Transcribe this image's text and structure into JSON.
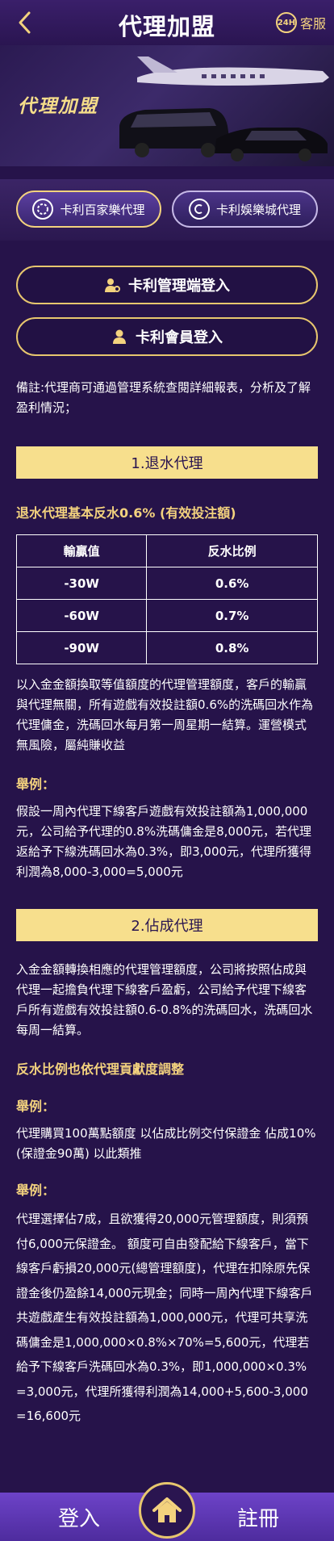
{
  "header": {
    "back_icon": "chevron-left-icon",
    "title": "代理加盟",
    "cs_icon_text": "24H",
    "cs_label": "客服",
    "accent_color": "#f3d27e"
  },
  "banner": {
    "title": "代理加盟"
  },
  "tabs": [
    {
      "label": "卡利百家樂代理",
      "icon": "chip-icon"
    },
    {
      "label": "卡利娛樂城代理",
      "icon": "casino-logo-icon"
    }
  ],
  "buttons": {
    "admin_login": "卡利管理端登入",
    "member_login": "卡利會員登入"
  },
  "note": "備註:代理商可通過管理系統查閱詳細報表，分析及了解盈利情況；",
  "section1": {
    "bar": "1.退水代理",
    "heading": "退水代理基本反水0.6% (有效投注額)",
    "table": {
      "headers": [
        "輸贏值",
        "反水比例"
      ],
      "rows": [
        [
          "-30W",
          "0.6%"
        ],
        [
          "-60W",
          "0.7%"
        ],
        [
          "-90W",
          "0.8%"
        ]
      ]
    },
    "desc": "以入金金額換取等值額度的代理管理額度，客戶的輸贏與代理無關，所有遊戲有效投註額0.6%的洗碼回水作為代理傭金，洗碼回水每月第一周星期一結算。運營模式無風險，屬純賺收益",
    "example_label": "舉例：",
    "example_text": "假設一周內代理下線客戶遊戲有效投註額為1,000,000元，公司給予代理的0.8%洗碼傭金是8,000元，若代理返給予下線洗碼回水為0.3%，即3,000元，代理所獲得利潤為8,000-3,000=5,000元"
  },
  "section2": {
    "bar": "2.佔成代理",
    "desc": "入金金額轉換相應的代理管理額度，公司將按照佔成與代理一起擔負代理下線客戶盈虧，公司給予代理下線客戶所有遊戲有效投註額0.6-0.8%的洗碼回水，洗碼回水每周一結算。",
    "heading": "反水比例也依代理貢獻度調整",
    "example1_label": "舉例：",
    "example1_text": "代理購買100萬點額度 以佔成比例交付保證金 佔成10% (保證金90萬) 以此類推",
    "example2_label": "舉例：",
    "example2_text": "代理選擇佔7成，且欲獲得20,000元管理額度，則須預付6,000元保證金。 額度可自由發配給下線客戶，當下線客戶虧損20,000元(總管理額度)，代理在扣除原先保證金後仍盈餘14,000元現金；同時一周內代理下線客戶共遊戲產生有效投註額為1,000,000元，代理可共享洗碼傭金是1,000,000×0.8%×70%=5,600元，代理若給予下線客戶洗碼回水為0.3%，即1,000,000×0.3% =3,000元，代理所獲得利潤為14,000+5,600-3,000 =16,600元"
  },
  "bottom_nav": {
    "login": "登入",
    "register": "註冊",
    "home_icon": "home-icon"
  }
}
